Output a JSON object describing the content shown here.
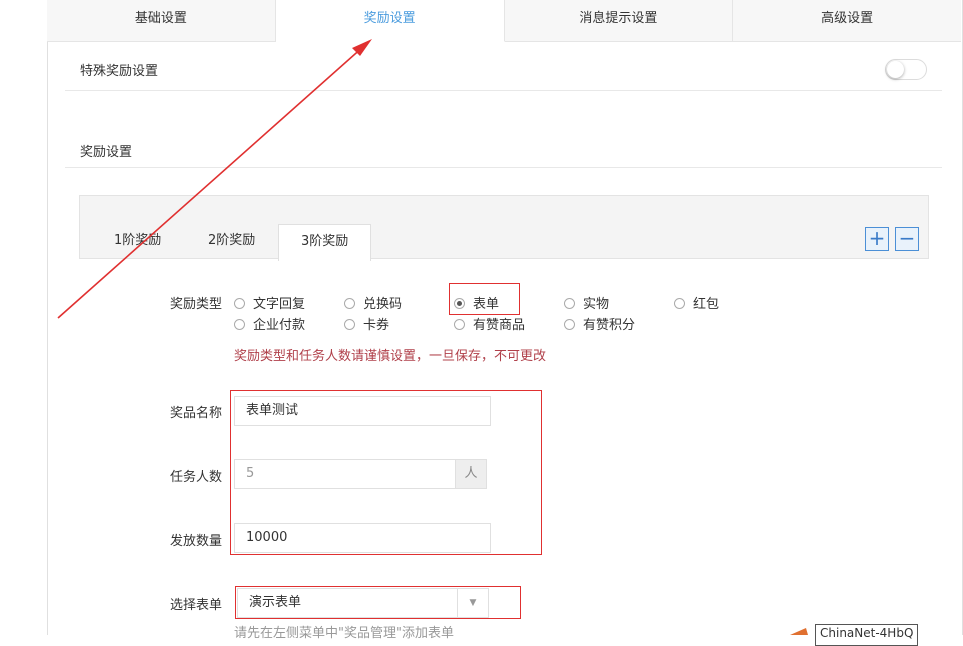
{
  "top_tabs": [
    "基础设置",
    "奖励设置",
    "消息提示设置",
    "高级设置"
  ],
  "special_reward": {
    "label": "特殊奖励设置",
    "enabled": false
  },
  "reward_section": {
    "label": "奖励设置"
  },
  "tiers": {
    "tabs": [
      "1阶奖励",
      "2阶奖励",
      "3阶奖励"
    ],
    "active_index": 2,
    "add_label": "+",
    "remove_label": "−"
  },
  "reward_type": {
    "label": "奖励类型",
    "options": [
      "文字回复",
      "兑换码",
      "表单",
      "实物",
      "红包",
      "企业付款",
      "卡券",
      "有赞商品",
      "有赞积分"
    ],
    "selected": "表单",
    "warning": "奖励类型和任务人数请谨慎设置，一旦保存，不可更改"
  },
  "prize_name": {
    "label": "奖品名称",
    "value": "表单测试"
  },
  "task_people": {
    "label": "任务人数",
    "value": "5",
    "unit": "人"
  },
  "issue_count": {
    "label": "发放数量",
    "value": "10000"
  },
  "form_select": {
    "label": "选择表单",
    "value": "演示表单",
    "hint": "请先在左侧菜单中\"奖品管理\"添加表单"
  },
  "tooltip": {
    "text": "ChinaNet-4HbQ"
  },
  "colors": {
    "accent": "#4b9cde",
    "annotation": "#e03030",
    "warning": "#b0404a"
  }
}
